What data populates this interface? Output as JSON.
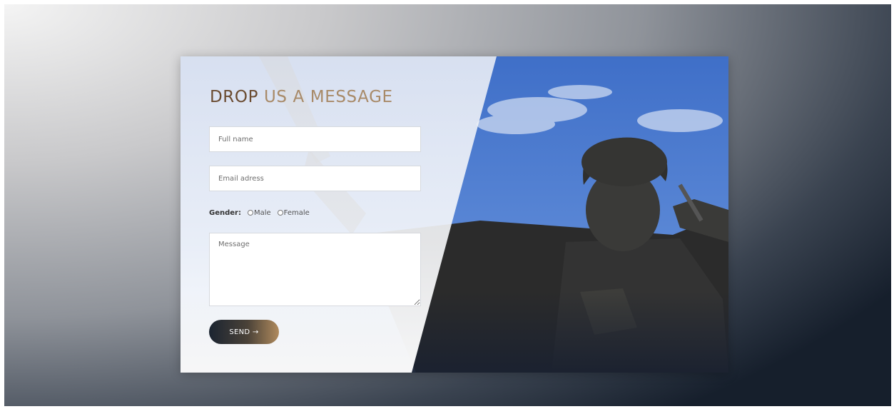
{
  "form": {
    "title_accent": "DROP",
    "title_rest": " US A MESSAGE",
    "name_placeholder": "Full name",
    "email_placeholder": "Email adress",
    "gender_label": "Gender:",
    "gender_options": [
      "Male",
      "Female"
    ],
    "message_placeholder": "Message",
    "send_label": "SEND →"
  },
  "colors": {
    "title_accent": "#6a4b30",
    "title": "#a88a68",
    "button_start": "#1b2431",
    "button_end": "#b08a5d",
    "sky": "#4f7fd0"
  },
  "image": {
    "subject": "statue-photo"
  }
}
